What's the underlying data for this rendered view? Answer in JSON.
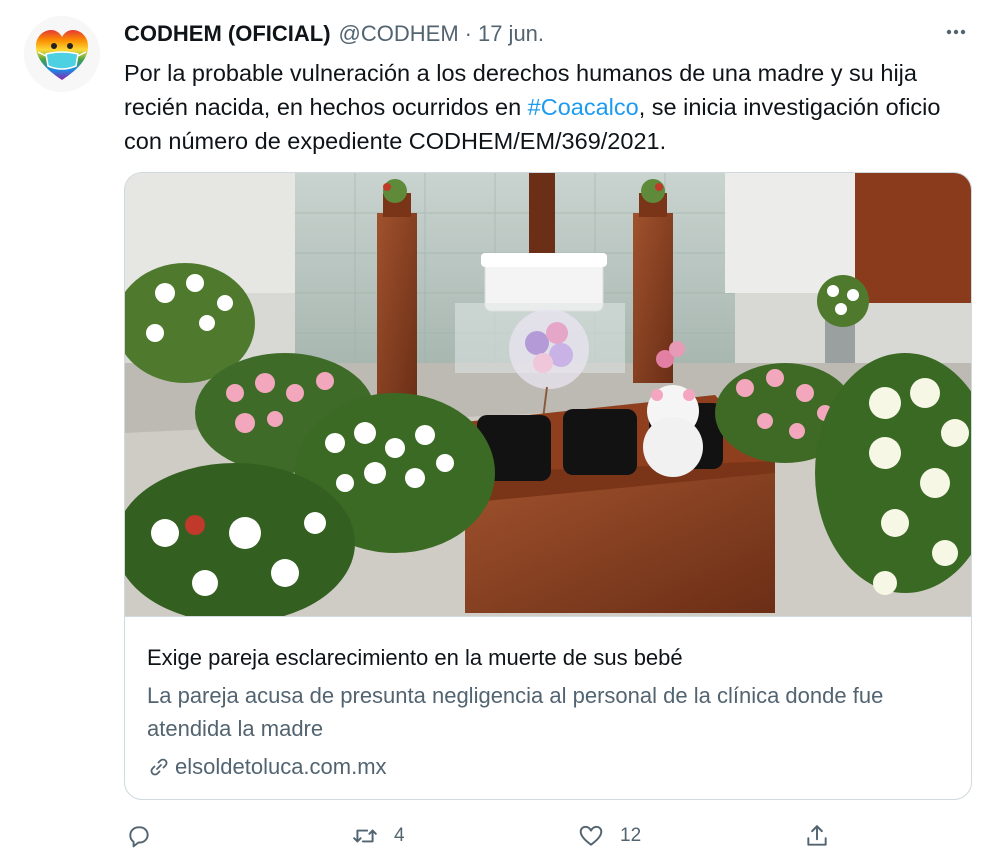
{
  "tweet": {
    "name": "CODHEM (OFICIAL)",
    "handle": "@CODHEM",
    "separator": "·",
    "date": "17 jun.",
    "text_before": "Por la probable vulneración a los derechos humanos de una madre y su hija recién nacida, en hechos ocurridos en ",
    "hashtag": "#Coacalco",
    "text_after": ", se inicia investigación oficio con número de expediente CODHEM/EM/369/2021."
  },
  "card": {
    "title": "Exige pareja esclarecimiento en la muerte de sus bebé",
    "description": "La pareja acusa de presunta negligencia al personal de la clínica donde fue atendida la madre",
    "domain": "elsoldetoluca.com.mx"
  },
  "actions": {
    "reply_count": "",
    "retweet_count": "4",
    "like_count": "12"
  },
  "colors": {
    "link": "#1d9bf0",
    "secondary_text": "#536471",
    "border": "#cfd9de"
  },
  "icons": [
    "more-icon",
    "link-icon",
    "reply-icon",
    "retweet-icon",
    "like-icon",
    "share-icon"
  ]
}
